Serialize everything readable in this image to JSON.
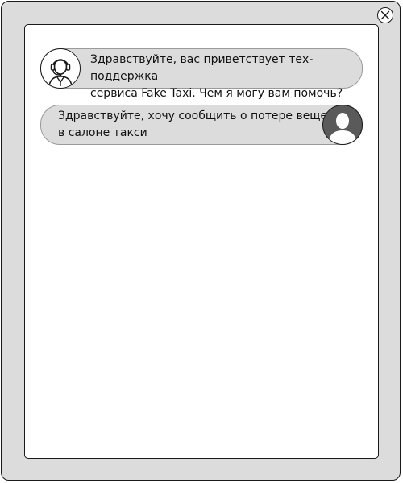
{
  "window": {
    "close_icon": "close-icon"
  },
  "chat": {
    "messages": [
      {
        "sender": "support",
        "avatar_icon": "support-agent-headset-icon",
        "text": "Здравствуйте, вас приветствует тех-поддержка\nсервиса Fake Taxi. Чем я могу вам помочь?"
      },
      {
        "sender": "user",
        "avatar_icon": "user-silhouette-icon",
        "text": "Здравствуйте, хочу сообщить о потере вещей\nв салоне такси"
      }
    ]
  },
  "colors": {
    "frame": "#dcdcdc",
    "panel": "#ffffff",
    "bubble": "#dcdcdc",
    "user_avatar": "#5a5a5a",
    "outline": "#1a1a1a"
  }
}
